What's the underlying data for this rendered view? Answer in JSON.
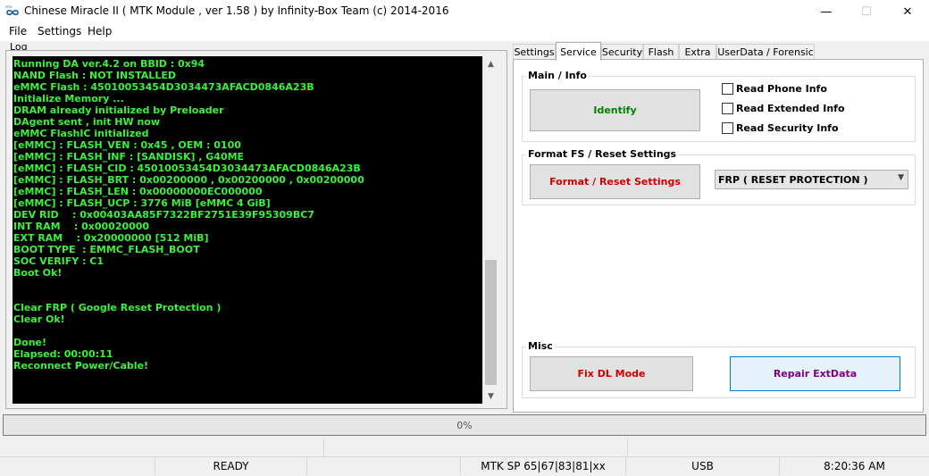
{
  "window": {
    "title": "Chinese Miracle II ( MTK Module , ver 1.58 ) by Infinity-Box Team (c) 2014-2016",
    "icon": "infinity-logo-icon",
    "controls": {
      "minimize": "—",
      "maximize": "☐",
      "close": "✕"
    }
  },
  "menu": [
    "File",
    "Settings",
    "Help"
  ],
  "log": {
    "label": "Log",
    "text_color": "#3cf03c",
    "lines": [
      "Running DA ver.4.2 on BBID : 0x94",
      "NAND Flash : NOT INSTALLED",
      "eMMC Flash : 45010053454D3034473AFACD0846A23B",
      "Initialize Memory ...",
      "DRAM already initialized by Preloader",
      "DAgent sent , init HW now",
      "eMMC FlashIC initialized",
      "[eMMC] : FLASH_VEN : 0x45 , OEM : 0100",
      "[eMMC] : FLASH_INF : [SANDISK] , G40ME",
      "[eMMC] : FLASH_CID : 45010053454D3034473AFACD0846A23B",
      "[eMMC] : FLASH_BRT : 0x00200000 , 0x00200000 , 0x00200000",
      "[eMMC] : FLASH_LEN : 0x00000000EC000000",
      "[eMMC] : FLASH_UCP : 3776 MiB [eMMC 4 GiB]",
      "DEV RID    : 0x00403AA85F7322BF2751E39F95309BC7",
      "INT RAM    : 0x00020000",
      "EXT RAM    : 0x20000000 [512 MiB]",
      "BOOT TYPE  : EMMC_FLASH_BOOT",
      "SOC VERIFY : C1",
      "Boot Ok!",
      "",
      "",
      "Clear FRP ( Google Reset Protection )",
      "Clear Ok!",
      "",
      "Done!",
      "Elapsed: 00:00:11",
      "Reconnect Power/Cable!"
    ]
  },
  "tabs": [
    "Settings",
    "Service",
    "Security",
    "Flash",
    "Extra",
    "UserData / Forensic"
  ],
  "active_tab": "Service",
  "service": {
    "main_info": {
      "title": "Main / Info",
      "identify_label": "Identify",
      "identify_color": "#008000",
      "checkboxes": [
        "Read Phone Info",
        "Read Extended Info",
        "Read Security Info"
      ]
    },
    "format": {
      "title": "Format FS / Reset Settings",
      "button_label": "Format / Reset Settings",
      "button_color": "#d00000",
      "select_value": "FRP ( RESET PROTECTION )"
    },
    "misc": {
      "title": "Misc",
      "fix_dl_label": "Fix DL Mode",
      "fix_dl_color": "#d00000",
      "repair_label": "Repair ExtData",
      "repair_color": "#800080"
    }
  },
  "progress": {
    "text": "0%",
    "value": 0
  },
  "status": {
    "state": "READY",
    "platform": "MTK SP 65|67|83|81|xx",
    "connection": "USB",
    "time": "8:20:36 AM"
  }
}
